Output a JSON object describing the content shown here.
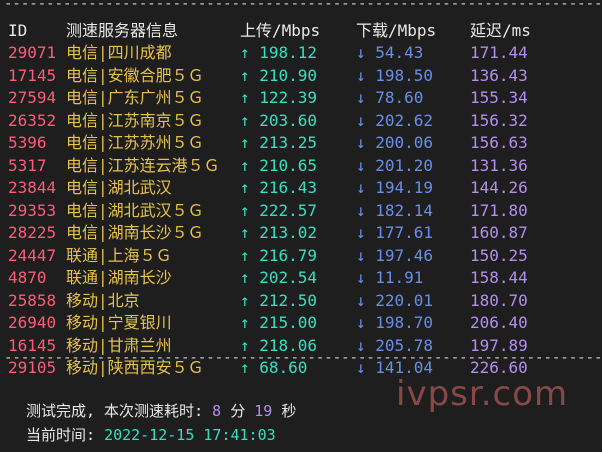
{
  "separator": "------------------------------------------------------------------------",
  "headers": {
    "id": "ID",
    "server": "测速服务器信息",
    "upload": "上传/Mbps",
    "download": "下载/Mbps",
    "latency": "延迟/ms"
  },
  "rows": [
    {
      "id": "29071",
      "server": "电信|四川成都",
      "up": "↑ 198.12",
      "down": "↓ 54.43",
      "lat": "171.44"
    },
    {
      "id": "17145",
      "server": "电信|安徽合肥５Ｇ",
      "up": "↑ 210.90",
      "down": "↓ 198.50",
      "lat": "136.43"
    },
    {
      "id": "27594",
      "server": "电信|广东广州５Ｇ",
      "up": "↑ 122.39",
      "down": "↓ 78.60",
      "lat": "155.34"
    },
    {
      "id": "26352",
      "server": "电信|江苏南京５Ｇ",
      "up": "↑ 203.60",
      "down": "↓ 202.62",
      "lat": "156.32"
    },
    {
      "id": "5396",
      "server": "电信|江苏苏州５Ｇ",
      "up": "↑ 213.25",
      "down": "↓ 200.06",
      "lat": "156.63"
    },
    {
      "id": "5317",
      "server": "电信|江苏连云港５Ｇ",
      "up": "↑ 210.65",
      "down": "↓ 201.20",
      "lat": "131.36"
    },
    {
      "id": "23844",
      "server": "电信|湖北武汉",
      "up": "↑ 216.43",
      "down": "↓ 194.19",
      "lat": "144.26"
    },
    {
      "id": "29353",
      "server": "电信|湖北武汉５Ｇ",
      "up": "↑ 222.57",
      "down": "↓ 182.14",
      "lat": "171.80"
    },
    {
      "id": "28225",
      "server": "电信|湖南长沙５Ｇ",
      "up": "↑ 213.02",
      "down": "↓ 177.61",
      "lat": "160.87"
    },
    {
      "id": "24447",
      "server": "联通|上海５Ｇ",
      "up": "↑ 216.79",
      "down": "↓ 197.46",
      "lat": "150.25"
    },
    {
      "id": "4870",
      "server": "联通|湖南长沙",
      "up": "↑ 202.54",
      "down": "↓ 11.91",
      "lat": "158.44"
    },
    {
      "id": "25858",
      "server": "移动|北京",
      "up": "↑ 212.50",
      "down": "↓ 220.01",
      "lat": "180.70"
    },
    {
      "id": "26940",
      "server": "移动|宁夏银川",
      "up": "↑ 215.00",
      "down": "↓ 198.70",
      "lat": "206.40"
    },
    {
      "id": "16145",
      "server": "移动|甘肃兰州",
      "up": "↑ 218.06",
      "down": "↓ 205.78",
      "lat": "197.89"
    },
    {
      "id": "29105",
      "server": "移动|陕西西安５Ｇ",
      "up": "↑ 68.60",
      "down": "↓ 141.04",
      "lat": "226.60"
    }
  ],
  "footer": {
    "completed_label": "测试完成, 本次测速耗时:",
    "minutes": "8",
    "min_unit": "分",
    "seconds": "19",
    "sec_unit": "秒",
    "time_label": "当前时间:",
    "time_value": "2022-12-15 17:41:03"
  },
  "watermark": "ivpsr.com"
}
